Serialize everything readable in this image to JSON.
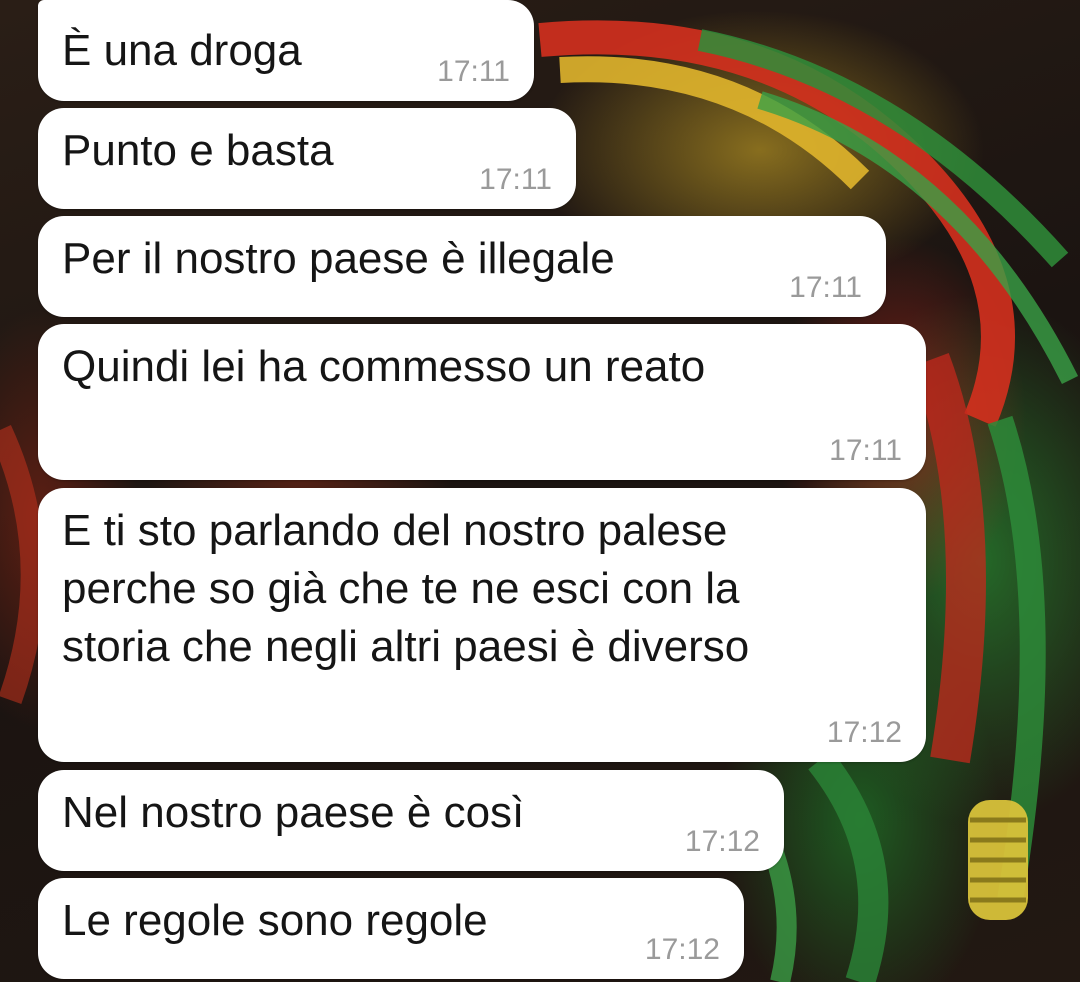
{
  "messages": [
    {
      "text": "È una droga",
      "time": "17:11"
    },
    {
      "text": "Punto e basta",
      "time": "17:11"
    },
    {
      "text": "Per il nostro paese è illegale",
      "time": "17:11"
    },
    {
      "text": "Quindi lei ha commesso un reato",
      "time": "17:11"
    },
    {
      "text": "E ti sto parlando del nostro palese\nperche so già che te ne esci con la\nstoria che negli altri paesi è diverso",
      "time": "17:12"
    },
    {
      "text": "Nel nostro paese è così",
      "time": "17:12"
    },
    {
      "text": "Le regole sono regole",
      "time": "17:12"
    }
  ]
}
